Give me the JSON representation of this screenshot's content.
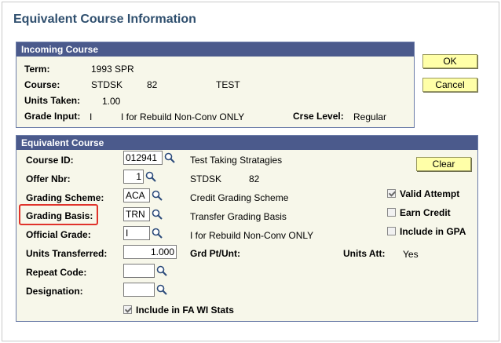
{
  "page": {
    "title": "Equivalent Course Information"
  },
  "buttons": {
    "ok_label": "OK",
    "cancel_label": "Cancel",
    "clear_label": "Clear"
  },
  "incoming": {
    "header": "Incoming Course",
    "term_label": "Term:",
    "term_value": "1993 SPR",
    "course_label": "Course:",
    "course_subject": "STDSK",
    "course_number": "82",
    "course_title": "TEST",
    "units_label": "Units Taken:",
    "units_value": "1.00",
    "grade_label": "Grade Input:",
    "grade_value": "I",
    "grade_desc": "I for Rebuild Non-Conv ONLY",
    "level_label": "Crse Level:",
    "level_value": "Regular"
  },
  "equivalent": {
    "header": "Equivalent Course",
    "course_id_label": "Course ID:",
    "course_id_value": "012941",
    "course_id_desc": "Test Taking Stratagies",
    "offer_label": "Offer Nbr:",
    "offer_value": "1",
    "offer_subject": "STDSK",
    "offer_number": "82",
    "scheme_label": "Grading Scheme:",
    "scheme_value": "ACA",
    "scheme_desc": "Credit Grading Scheme",
    "basis_label": "Grading Basis:",
    "basis_value": "TRN",
    "basis_desc": "Transfer Grading Basis",
    "official_label": "Official Grade:",
    "official_value": "I",
    "official_desc": "I for Rebuild Non-Conv ONLY",
    "units_label": "Units Transferred:",
    "units_value": "1.000",
    "gradept_label": "Grd Pt/Unt:",
    "unitsatt_label": "Units Att:",
    "unitsatt_value": "Yes",
    "repeat_label": "Repeat Code:",
    "repeat_value": "",
    "designation_label": "Designation:",
    "designation_value": "",
    "valid_attempt_label": "Valid Attempt",
    "earn_credit_label": "Earn Credit",
    "include_gpa_label": "Include in GPA",
    "include_fa_label": "Include in FA WI Stats"
  },
  "colors": {
    "header_bg": "#4b5a8c",
    "panel_bg": "#f7f7ea",
    "button_bg": "#ffffa8",
    "title": "#2f4f6e",
    "highlight": "#e0332b"
  },
  "icons": {
    "lookup": "magnifier-lookup-icon"
  }
}
